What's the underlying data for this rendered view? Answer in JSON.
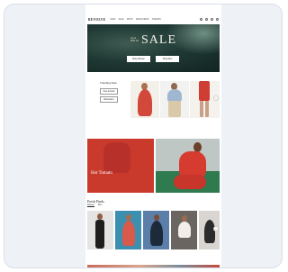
{
  "store": {
    "logo": "REVOLVE",
    "nav_menu": [
      "NEW",
      "SALE",
      "SHOP",
      "DESIGNERS",
      "TRENDS"
    ],
    "nav_icons": [
      "search-icon",
      "account-icon",
      "heart-icon",
      "bag-icon"
    ]
  },
  "hero": {
    "kicker": "Up to 65% off",
    "title": "SALE",
    "buttons": [
      "Shop Women",
      "Shop Men"
    ]
  },
  "trending": {
    "heading": "Trending Now",
    "chips": [
      "New Arrivals",
      "Bestsellers"
    ],
    "tiles": [
      {
        "caption": ""
      },
      {
        "caption": ""
      },
      {
        "caption": ""
      }
    ]
  },
  "feature": {
    "title": "Hot Tomato",
    "text": "",
    "link": ""
  },
  "fresh": {
    "heading": "Fresh Finds",
    "tabs": [
      "Women",
      "Men"
    ],
    "tiles": [
      {
        "caption": ""
      },
      {
        "caption": ""
      },
      {
        "caption": ""
      },
      {
        "caption": ""
      },
      {
        "caption": ""
      }
    ]
  },
  "colors": {
    "hero_bg": "#1f3833",
    "accent_red": "#c93a2c",
    "card_bg": "#eef1f6"
  }
}
